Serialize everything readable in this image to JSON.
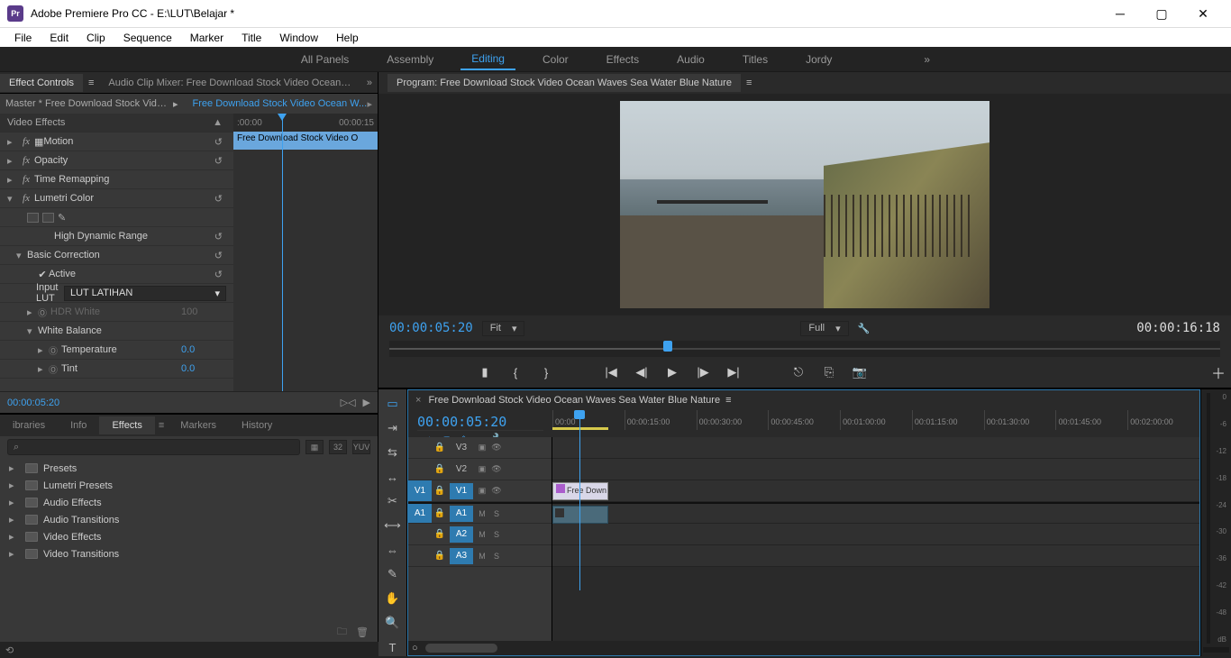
{
  "titlebar": {
    "app": "Adobe Premiere Pro CC",
    "doc": "E:\\LUT\\Belajar *",
    "logo": "Pr"
  },
  "menu": [
    "File",
    "Edit",
    "Clip",
    "Sequence",
    "Marker",
    "Title",
    "Window",
    "Help"
  ],
  "workspaces": {
    "items": [
      "All Panels",
      "Assembly",
      "Editing",
      "Color",
      "Effects",
      "Audio",
      "Titles",
      "Jordy"
    ],
    "active": "Editing"
  },
  "effect_controls": {
    "tabs": {
      "active": "Effect Controls",
      "other": "Audio Clip Mixer: Free Download Stock Video Ocean Waves Sea Water Blue Nature"
    },
    "master": "Master * Free Download Stock Video Oc...",
    "clip": "Free Download Stock Video Ocean W...",
    "section": "Video Effects",
    "motion": "Motion",
    "opacity": "Opacity",
    "time_remap": "Time Remapping",
    "lumetri": "Lumetri Color",
    "hdr": "High Dynamic Range",
    "basic": "Basic Correction",
    "active": "Active",
    "input_lut_label": "Input LUT",
    "input_lut_value": "LUT LATIHAN",
    "hdr_white": "HDR White",
    "hdr_white_val": "100",
    "white_balance": "White Balance",
    "temperature": "Temperature",
    "temperature_val": "0.0",
    "tint": "Tint",
    "tint_val": "0.0",
    "mini_start": ":00:00",
    "mini_end": "00:00:15",
    "mini_clip": "Free Download Stock Video O",
    "timecode": "00:00:05:20"
  },
  "effects_panel": {
    "tabs": [
      "ibraries",
      "Info",
      "Effects",
      "Markers",
      "History"
    ],
    "active": "Effects",
    "search_placeholder": "",
    "badges": [
      "32",
      "YUV"
    ],
    "folders": [
      "Presets",
      "Lumetri Presets",
      "Audio Effects",
      "Audio Transitions",
      "Video Effects",
      "Video Transitions"
    ]
  },
  "program": {
    "title": "Program: Free Download Stock Video Ocean Waves Sea Water Blue Nature",
    "timecode": "00:00:05:20",
    "fit": "Fit",
    "quality": "Full",
    "duration": "00:00:16:18"
  },
  "timeline": {
    "sequence": "Free Download Stock Video Ocean Waves Sea Water Blue Nature",
    "timecode": "00:00:05:20",
    "ticks": [
      "00:00",
      "00:00:15:00",
      "00:00:30:00",
      "00:00:45:00",
      "00:01:00:00",
      "00:01:15:00",
      "00:01:30:00",
      "00:01:45:00",
      "00:02:00:00"
    ],
    "tracks": {
      "v3": "V3",
      "v2": "V2",
      "v1": "V1",
      "a1": "A1",
      "a2": "A2",
      "a3": "A3"
    },
    "clip_name": "Free Down"
  },
  "meters": [
    "0",
    "-6",
    "-12",
    "-18",
    "-24",
    "-30",
    "-36",
    "-42",
    "-48",
    "dB"
  ]
}
